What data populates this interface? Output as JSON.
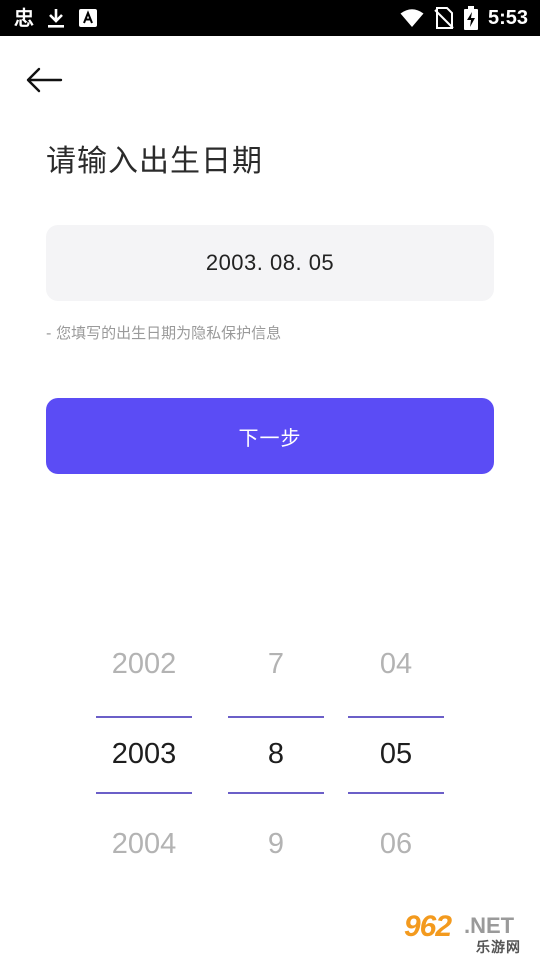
{
  "status_bar": {
    "app_glyph": "忠",
    "time": "5:53",
    "icons": [
      "download-icon",
      "app-notification-icon",
      "wifi-icon",
      "no-sim-icon",
      "battery-charging-icon"
    ]
  },
  "header": {
    "back_icon": "arrow-left-icon",
    "title": "请输入出生日期"
  },
  "date_field": {
    "value": "2003. 08. 05"
  },
  "privacy_note": "- 您填写的出生日期为隐私保护信息",
  "next_button": {
    "label": "下一步",
    "color": "#5b4cf5"
  },
  "picker": {
    "accent": "#6b5fc8",
    "year": {
      "prev": "2002",
      "selected": "2003",
      "next": "2004"
    },
    "month": {
      "prev": "7",
      "selected": "8",
      "next": "9"
    },
    "day": {
      "prev": "04",
      "selected": "05",
      "next": "06"
    }
  },
  "watermark": {
    "number": "962",
    "suffix": ".NET",
    "sub": "乐游网"
  }
}
